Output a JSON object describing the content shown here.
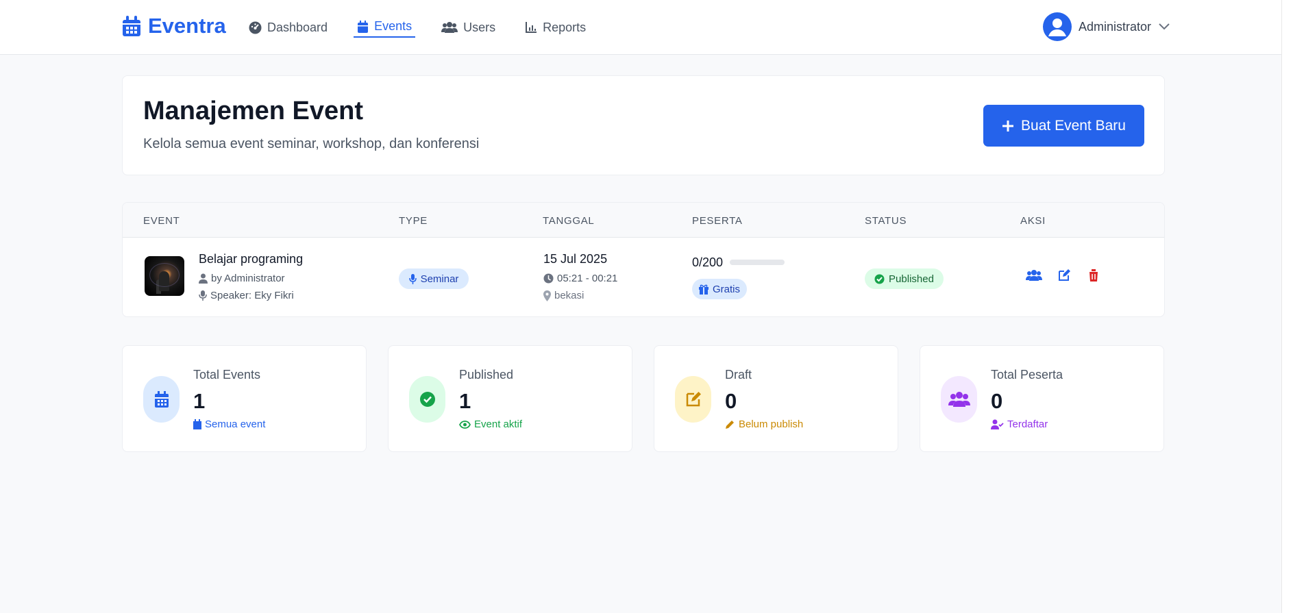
{
  "app": {
    "brand": "Eventra"
  },
  "nav": {
    "items": [
      {
        "label": "Dashboard",
        "icon": "dashboard-icon"
      },
      {
        "label": "Events",
        "icon": "calendar-icon"
      },
      {
        "label": "Users",
        "icon": "users-icon"
      },
      {
        "label": "Reports",
        "icon": "reports-icon"
      }
    ]
  },
  "user": {
    "name": "Administrator"
  },
  "header": {
    "title": "Manajemen Event",
    "subtitle": "Kelola semua event seminar, workshop, dan konferensi",
    "primary_button": "Buat Event Baru"
  },
  "table": {
    "columns": [
      "EVENT",
      "TYPE",
      "TANGGAL",
      "PESERTA",
      "STATUS",
      "AKSI"
    ],
    "rows": [
      {
        "title": "Belajar programing",
        "author": "by Administrator",
        "speaker": "Speaker: Eky Fikri",
        "type": "Seminar",
        "date": "15 Jul 2025",
        "time": "05:21 - 00:21",
        "location": "bekasi",
        "participants": "0/200",
        "participant_fill": 0,
        "price": "Gratis",
        "status": "Published"
      }
    ]
  },
  "stats": [
    {
      "label": "Total Events",
      "value": "1",
      "note": "Semua event",
      "color": "#2563eb",
      "icon": "calendar-icon"
    },
    {
      "label": "Published",
      "value": "1",
      "note": "Event aktif",
      "color": "#16a34a",
      "icon": "check-circle-icon"
    },
    {
      "label": "Draft",
      "value": "0",
      "note": "Belum publish",
      "color": "#ca8a04",
      "icon": "edit-icon"
    },
    {
      "label": "Total Peserta",
      "value": "0",
      "note": "Terdaftar",
      "color": "#9333ea",
      "icon": "users-icon"
    }
  ],
  "colors": {
    "primary": "#2563eb",
    "success": "#16a34a",
    "warning": "#ca8a04",
    "purple": "#9333ea",
    "danger": "#dc2626"
  }
}
